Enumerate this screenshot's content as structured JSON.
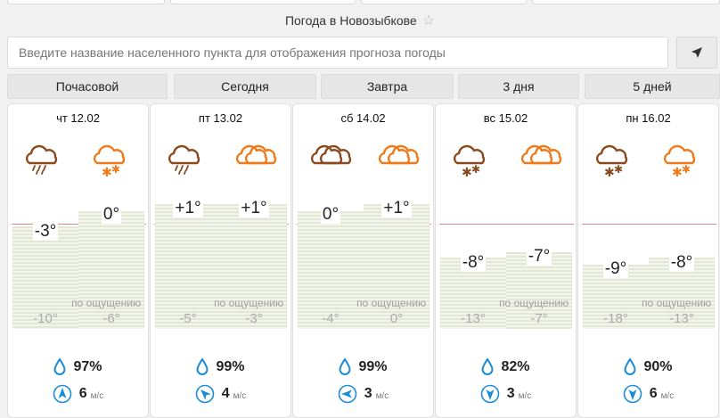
{
  "header": {
    "title": "Погода в Новозыбкове",
    "star_icon": "star-icon"
  },
  "search": {
    "placeholder": "Введите название населенного пункта для отображения прогноза погоды",
    "locate_icon": "location-arrow-icon"
  },
  "tabs": [
    {
      "label": "Почасовой"
    },
    {
      "label": "Сегодня"
    },
    {
      "label": "Завтра"
    },
    {
      "label": "3 дня"
    },
    {
      "label": "5 дней"
    }
  ],
  "feels_label": "по ощущению",
  "wind_unit": "м/с",
  "colors": {
    "brown": "#8a4a20",
    "orange": "#f07a1a",
    "blue": "#1b8bd8",
    "ref_line": "#d88a8a"
  },
  "days": [
    {
      "date": "чт 12.02",
      "icons": [
        "cloud-rain-brown-icon",
        "cloud-snow-orange-icon"
      ],
      "temps": [
        "-3°",
        "0°"
      ],
      "feels": [
        "-10°",
        "-6°"
      ],
      "humidity": "97%",
      "wind": "6",
      "wind_dir": "north"
    },
    {
      "date": "пт 13.02",
      "icons": [
        "cloud-rain-brown-icon",
        "cloud-orange-icon"
      ],
      "temps": [
        "+1°",
        "+1°"
      ],
      "feels": [
        "-5°",
        "-3°"
      ],
      "humidity": "99%",
      "wind": "4",
      "wind_dir": "northwest"
    },
    {
      "date": "сб 14.02",
      "icons": [
        "cloud-brown-icon",
        "cloud-orange-icon"
      ],
      "temps": [
        "0°",
        "+1°"
      ],
      "feels": [
        "-4°",
        "0°"
      ],
      "humidity": "99%",
      "wind": "3",
      "wind_dir": "west"
    },
    {
      "date": "вс 15.02",
      "icons": [
        "cloud-snow-brown-icon",
        "cloud-orange-icon"
      ],
      "temps": [
        "-8°",
        "-7°"
      ],
      "feels": [
        "-13°",
        "-7°"
      ],
      "humidity": "82%",
      "wind": "3",
      "wind_dir": "south"
    },
    {
      "date": "пн 16.02",
      "icons": [
        "cloud-snow-brown-icon",
        "cloud-snow-orange-icon"
      ],
      "temps": [
        "-9°",
        "-8°"
      ],
      "feels": [
        "-18°",
        "-13°"
      ],
      "humidity": "90%",
      "wind": "6",
      "wind_dir": "south"
    }
  ]
}
